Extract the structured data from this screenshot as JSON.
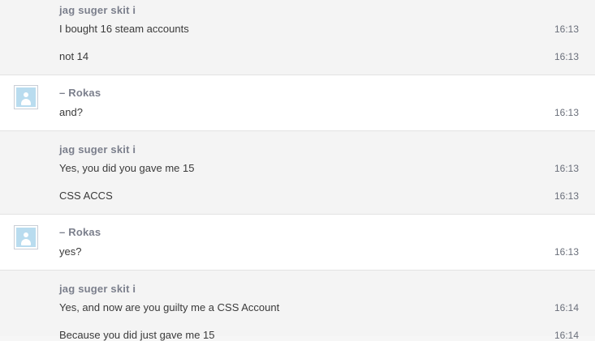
{
  "groups": [
    {
      "sender": "jag suger skit i",
      "messages": [
        {
          "text": "I bought 16 steam accounts",
          "time": "16:13"
        },
        {
          "text": "not 14",
          "time": "16:13"
        }
      ]
    },
    {
      "sender": "– Rokas",
      "avatar": "user-avatar-icon",
      "messages": [
        {
          "text": "and?",
          "time": "16:13"
        }
      ]
    },
    {
      "sender": "jag suger skit i",
      "messages": [
        {
          "text": "Yes, you did you gave me 15",
          "time": "16:13"
        },
        {
          "text": "CSS ACCS",
          "time": "16:13"
        }
      ]
    },
    {
      "sender": "– Rokas",
      "avatar": "user-avatar-icon",
      "messages": [
        {
          "text": "yes?",
          "time": "16:13"
        }
      ]
    },
    {
      "sender": "jag suger skit i",
      "messages": [
        {
          "text": "Yes, and now are you guilty me a CSS Account",
          "time": "16:14"
        },
        {
          "text": "Because you did just gave me 15",
          "time": "16:14"
        }
      ]
    }
  ],
  "colors": {
    "sender": "#7b7f8c",
    "message": "#3a3a3a",
    "time": "#6a6f7a",
    "grey_bg": "#f4f4f4",
    "white_bg": "#ffffff",
    "avatar": "#b9dcef"
  }
}
